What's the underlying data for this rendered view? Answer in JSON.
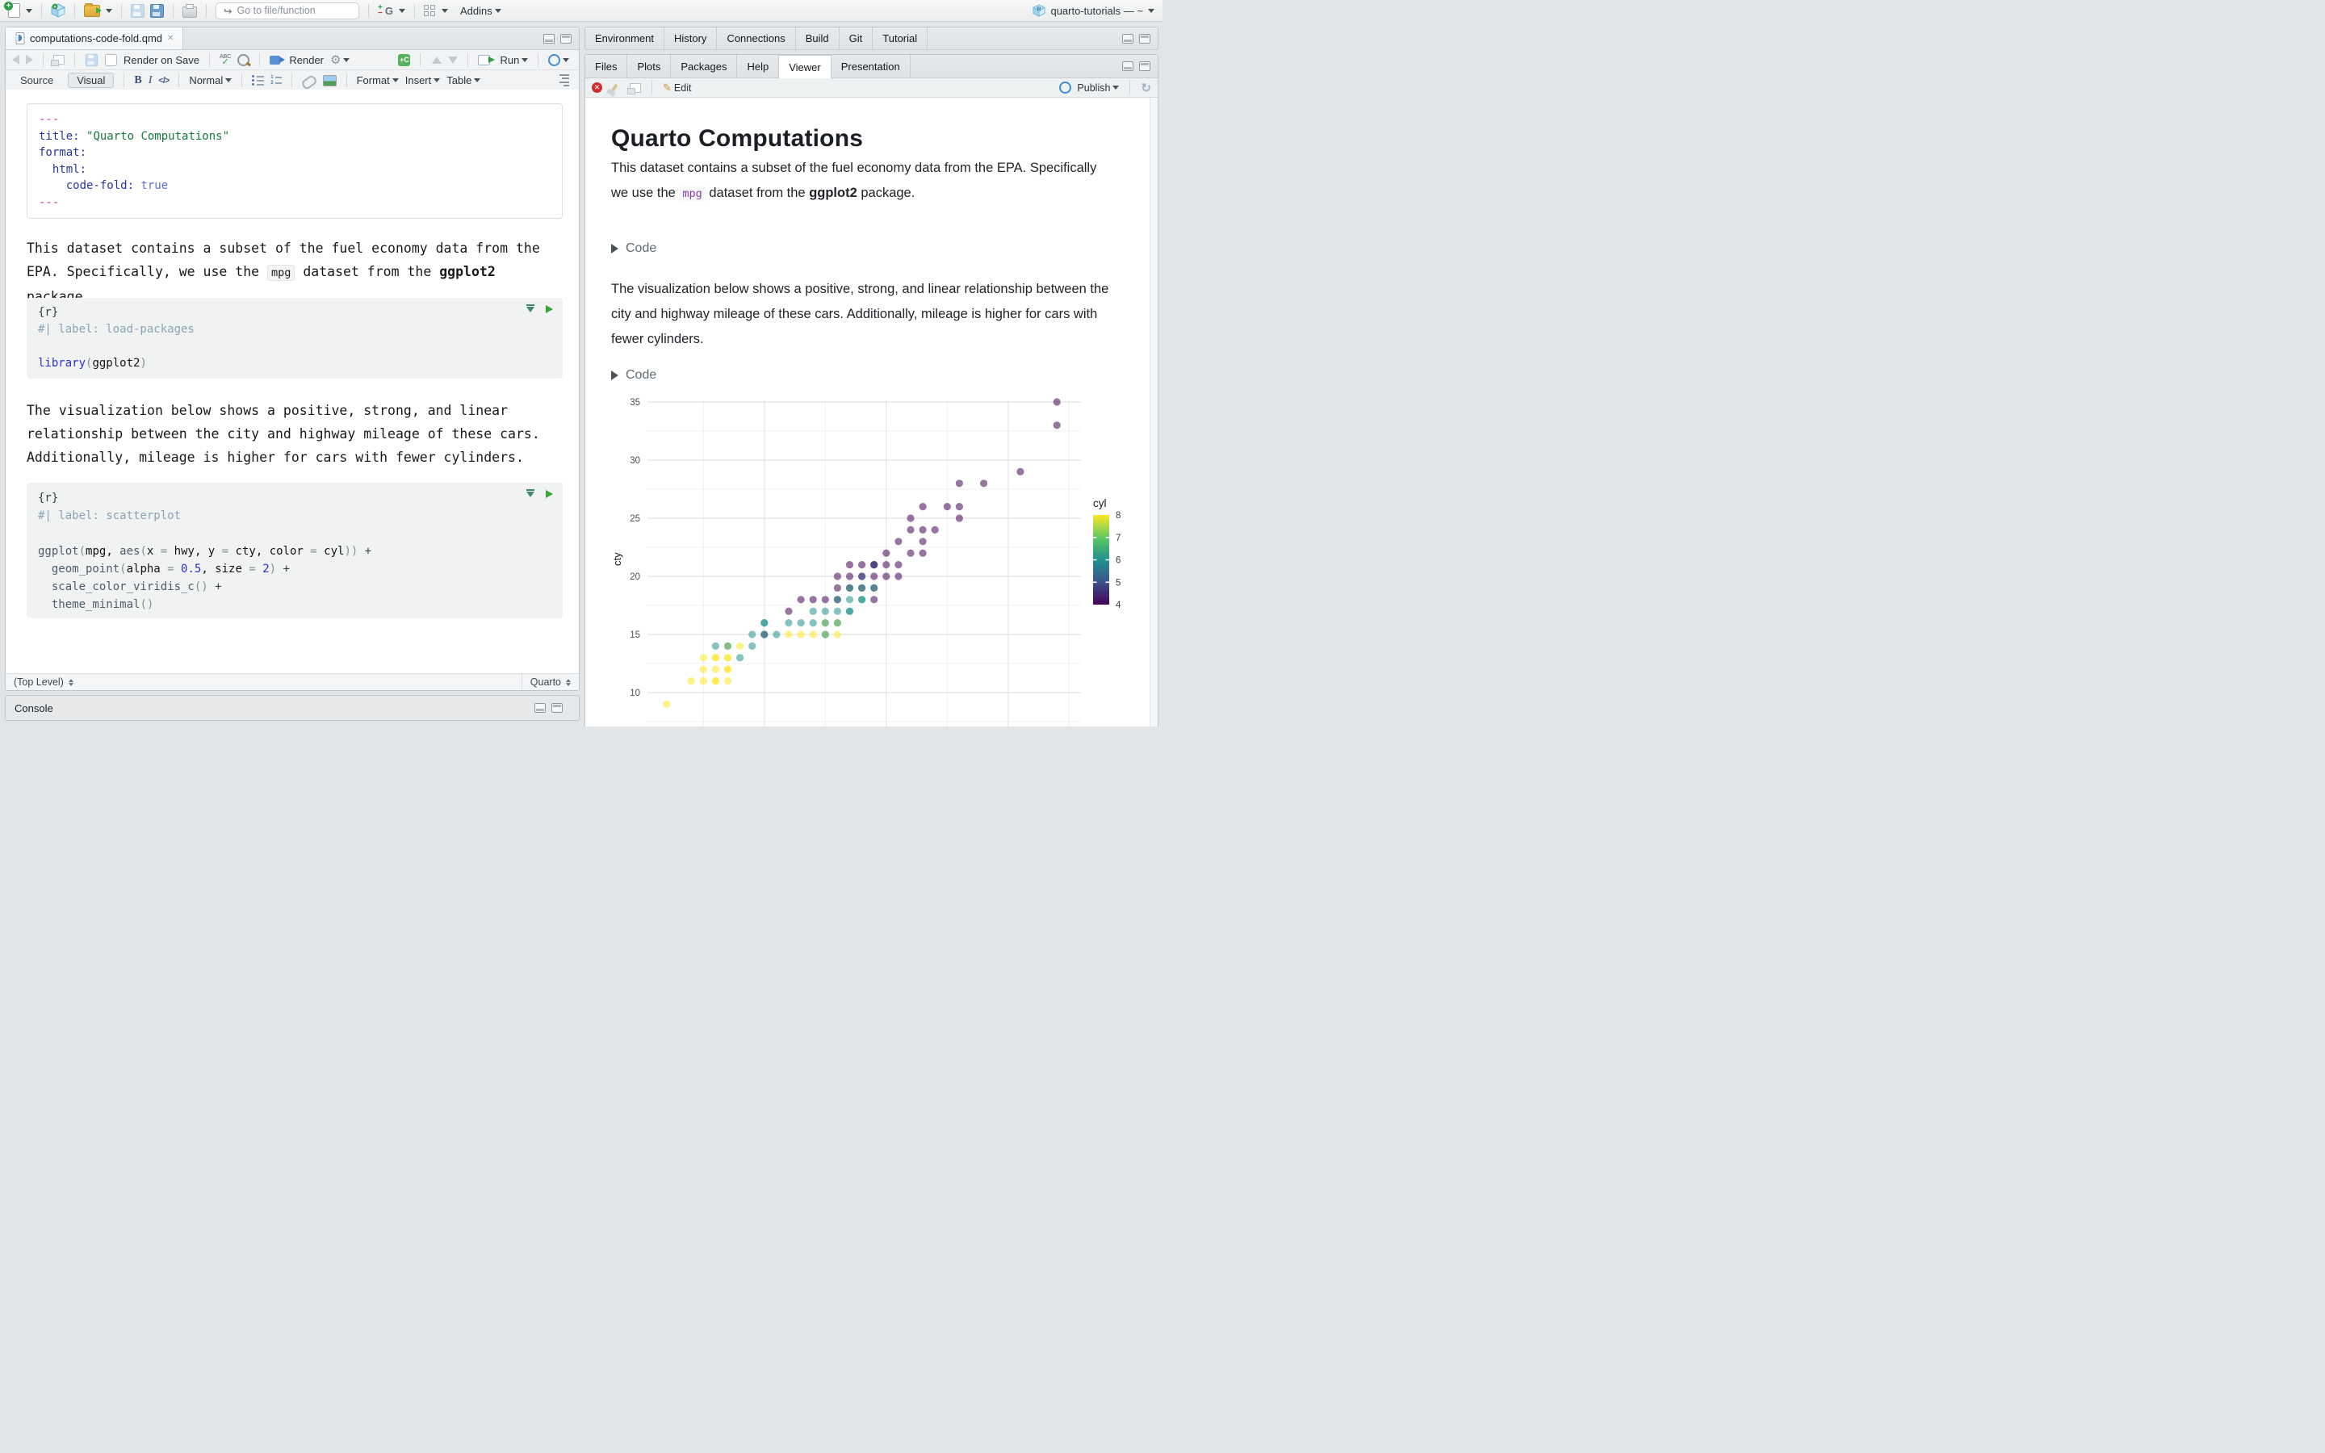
{
  "window": {
    "project_label": "quarto-tutorials — ~"
  },
  "topbar": {
    "goto_placeholder": "Go to file/function",
    "addins_label": "Addins"
  },
  "editor": {
    "tab_title": "computations-code-fold.qmd",
    "toolbar": {
      "render_on_save": "Render on Save",
      "render": "Render",
      "run": "Run",
      "source": "Source",
      "visual": "Visual",
      "paragraph_style": "Normal",
      "format": "Format",
      "insert": "Insert",
      "table": "Table"
    },
    "yaml_lines": [
      [
        [
          "d",
          "---"
        ]
      ],
      [
        [
          "k",
          "title:"
        ],
        [
          "n",
          " "
        ],
        [
          "s",
          "\"Quarto Computations\""
        ]
      ],
      [
        [
          "k",
          "format:"
        ]
      ],
      [
        [
          "n",
          "  "
        ],
        [
          "k",
          "html:"
        ]
      ],
      [
        [
          "n",
          "    "
        ],
        [
          "k",
          "code-fold:"
        ],
        [
          "n",
          " "
        ],
        [
          "b",
          "true"
        ]
      ],
      [
        [
          "d",
          "---"
        ]
      ]
    ],
    "para1": [
      {
        "text": "This dataset contains a subset of the fuel economy data from the EPA. Specifically, we use the "
      },
      {
        "code": "mpg"
      },
      {
        "text": " dataset from the "
      },
      {
        "bold": "ggplot2"
      },
      {
        "text": " package."
      }
    ],
    "chunk1_lines": [
      [
        [
          "n",
          "{r}"
        ]
      ],
      [
        [
          "c",
          "#| label: load-packages"
        ]
      ],
      [],
      [
        [
          "l",
          "library"
        ],
        [
          "p",
          "("
        ],
        [
          "i",
          "ggplot2"
        ],
        [
          "p",
          ")"
        ]
      ]
    ],
    "para2": "The visualization below shows a positive, strong, and linear relationship between the city and highway mileage of these cars. Additionally, mileage is higher for cars with fewer cylinders.",
    "chunk2_lines": [
      [
        [
          "n",
          "{r}"
        ]
      ],
      [
        [
          "c",
          "#| label: scatterplot"
        ]
      ],
      [],
      [
        [
          "f",
          "ggplot"
        ],
        [
          "p",
          "("
        ],
        [
          "i",
          "mpg"
        ],
        [
          "i",
          ", "
        ],
        [
          "f",
          "aes"
        ],
        [
          "p",
          "("
        ],
        [
          "i",
          "x"
        ],
        [
          "o",
          " = "
        ],
        [
          "i",
          "hwy"
        ],
        [
          "i",
          ", "
        ],
        [
          "i",
          "y"
        ],
        [
          "o",
          " = "
        ],
        [
          "i",
          "cty"
        ],
        [
          "i",
          ", "
        ],
        [
          "i",
          "color"
        ],
        [
          "o",
          " = "
        ],
        [
          "i",
          "cyl"
        ],
        [
          "p",
          "))"
        ],
        [
          "n",
          " +"
        ]
      ],
      [
        [
          "n",
          "  "
        ],
        [
          "f",
          "geom_point"
        ],
        [
          "p",
          "("
        ],
        [
          "i",
          "alpha"
        ],
        [
          "o",
          " = "
        ],
        [
          "u",
          "0.5"
        ],
        [
          "i",
          ", "
        ],
        [
          "i",
          "size"
        ],
        [
          "o",
          " = "
        ],
        [
          "u",
          "2"
        ],
        [
          "p",
          ")"
        ],
        [
          "n",
          " +"
        ]
      ],
      [
        [
          "n",
          "  "
        ],
        [
          "f",
          "scale_color_viridis_c"
        ],
        [
          "p",
          "()"
        ],
        [
          "n",
          " +"
        ]
      ],
      [
        [
          "n",
          "  "
        ],
        [
          "f",
          "theme_minimal"
        ],
        [
          "p",
          "()"
        ]
      ]
    ],
    "status_left": "(Top Level)",
    "status_right": "Quarto"
  },
  "console": {
    "title": "Console"
  },
  "right": {
    "top_tabs": [
      "Environment",
      "History",
      "Connections",
      "Build",
      "Git",
      "Tutorial"
    ],
    "bottom_tabs": [
      "Files",
      "Plots",
      "Packages",
      "Help",
      "Viewer",
      "Presentation"
    ],
    "active_bottom_tab": "Viewer",
    "viewer_toolbar": {
      "edit": "Edit",
      "publish": "Publish"
    }
  },
  "document": {
    "title": "Quarto Computations",
    "para1": [
      {
        "text": "This dataset contains a subset of the fuel economy data from the EPA. Specifically we use the "
      },
      {
        "code": "mpg"
      },
      {
        "text": " dataset from the "
      },
      {
        "bold": "ggplot2"
      },
      {
        "text": " package."
      }
    ],
    "code_fold_label": "Code",
    "para2": "The visualization below shows a positive, strong, and linear relationship between the city and highway mileage of these cars. Additionally, mileage is higher for cars with fewer cylinders."
  },
  "chart_data": {
    "type": "scatter",
    "title": "",
    "x_variable": "hwy",
    "y_variable": "cty",
    "color_variable": "cyl",
    "ylabel": "cty",
    "yticks": [
      10,
      15,
      20,
      25,
      30,
      35
    ],
    "x_gridlines_major": [
      20,
      30,
      40
    ],
    "x_gridlines_minor": [
      15,
      25,
      35,
      45
    ],
    "xlim": [
      10.4,
      46
    ],
    "ylim_visible": [
      7.5,
      37
    ],
    "grid": true,
    "x_axis_labels_visible": false,
    "point_alpha": 0.5,
    "point_size": 2,
    "legend": {
      "position": "right",
      "title": "cyl",
      "tick_labels": [
        8,
        7,
        6,
        5,
        4
      ],
      "colormap": "viridis",
      "gradient_stops": [
        "#fde725",
        "#5ec962",
        "#21918c",
        "#3b528b",
        "#440154"
      ]
    },
    "cyl_colors": {
      "4": "#440154",
      "5": "#3b528b",
      "6": "#21918c",
      "8": "#fde725"
    },
    "points": [
      [
        12,
        9,
        8
      ],
      [
        14,
        11,
        8
      ],
      [
        15,
        11,
        8
      ],
      [
        16,
        11,
        8
      ],
      [
        16,
        11,
        8
      ],
      [
        17,
        11,
        8
      ],
      [
        15,
        12,
        8
      ],
      [
        16,
        12,
        8
      ],
      [
        17,
        12,
        8
      ],
      [
        17,
        12,
        8
      ],
      [
        15,
        13,
        8
      ],
      [
        16,
        13,
        8
      ],
      [
        16,
        13,
        8
      ],
      [
        17,
        13,
        8
      ],
      [
        17,
        13,
        8
      ],
      [
        18,
        13,
        6
      ],
      [
        16,
        14,
        6
      ],
      [
        17,
        14,
        8
      ],
      [
        17,
        14,
        6
      ],
      [
        18,
        14,
        8
      ],
      [
        19,
        14,
        6
      ],
      [
        19,
        15,
        6
      ],
      [
        20,
        15,
        4
      ],
      [
        20,
        15,
        6
      ],
      [
        21,
        15,
        6
      ],
      [
        22,
        15,
        8
      ],
      [
        23,
        15,
        8
      ],
      [
        24,
        15,
        8
      ],
      [
        25,
        15,
        8
      ],
      [
        25,
        15,
        6
      ],
      [
        26,
        15,
        8
      ],
      [
        20,
        16,
        6
      ],
      [
        20,
        16,
        6
      ],
      [
        22,
        16,
        6
      ],
      [
        23,
        16,
        6
      ],
      [
        24,
        16,
        6
      ],
      [
        25,
        16,
        8
      ],
      [
        25,
        16,
        6
      ],
      [
        26,
        16,
        8
      ],
      [
        26,
        16,
        6
      ],
      [
        22,
        17,
        4
      ],
      [
        24,
        17,
        6
      ],
      [
        25,
        17,
        6
      ],
      [
        26,
        17,
        6
      ],
      [
        27,
        17,
        6
      ],
      [
        27,
        17,
        6
      ],
      [
        23,
        18,
        4
      ],
      [
        24,
        18,
        4
      ],
      [
        25,
        18,
        4
      ],
      [
        26,
        18,
        4
      ],
      [
        26,
        18,
        6
      ],
      [
        27,
        18,
        6
      ],
      [
        28,
        18,
        6
      ],
      [
        28,
        18,
        6
      ],
      [
        29,
        18,
        4
      ],
      [
        26,
        19,
        4
      ],
      [
        27,
        19,
        4
      ],
      [
        27,
        19,
        6
      ],
      [
        28,
        19,
        4
      ],
      [
        28,
        19,
        6
      ],
      [
        29,
        19,
        4
      ],
      [
        29,
        19,
        6
      ],
      [
        26,
        20,
        4
      ],
      [
        27,
        20,
        4
      ],
      [
        28,
        20,
        4
      ],
      [
        28,
        20,
        5
      ],
      [
        29,
        20,
        4
      ],
      [
        30,
        20,
        4
      ],
      [
        31,
        20,
        4
      ],
      [
        27,
        21,
        4
      ],
      [
        28,
        21,
        4
      ],
      [
        29,
        21,
        4
      ],
      [
        29,
        21,
        4
      ],
      [
        29,
        21,
        5
      ],
      [
        30,
        21,
        4
      ],
      [
        31,
        21,
        4
      ],
      [
        30,
        22,
        4
      ],
      [
        32,
        22,
        4
      ],
      [
        33,
        22,
        4
      ],
      [
        31,
        23,
        4
      ],
      [
        33,
        23,
        4
      ],
      [
        32,
        24,
        4
      ],
      [
        33,
        24,
        4
      ],
      [
        34,
        24,
        4
      ],
      [
        32,
        25,
        4
      ],
      [
        36,
        25,
        4
      ],
      [
        33,
        26,
        4
      ],
      [
        35,
        26,
        4
      ],
      [
        36,
        26,
        4
      ],
      [
        36,
        28,
        4
      ],
      [
        38,
        28,
        4
      ],
      [
        41,
        29,
        4
      ],
      [
        44,
        33,
        4
      ],
      [
        44,
        35,
        4
      ]
    ]
  }
}
